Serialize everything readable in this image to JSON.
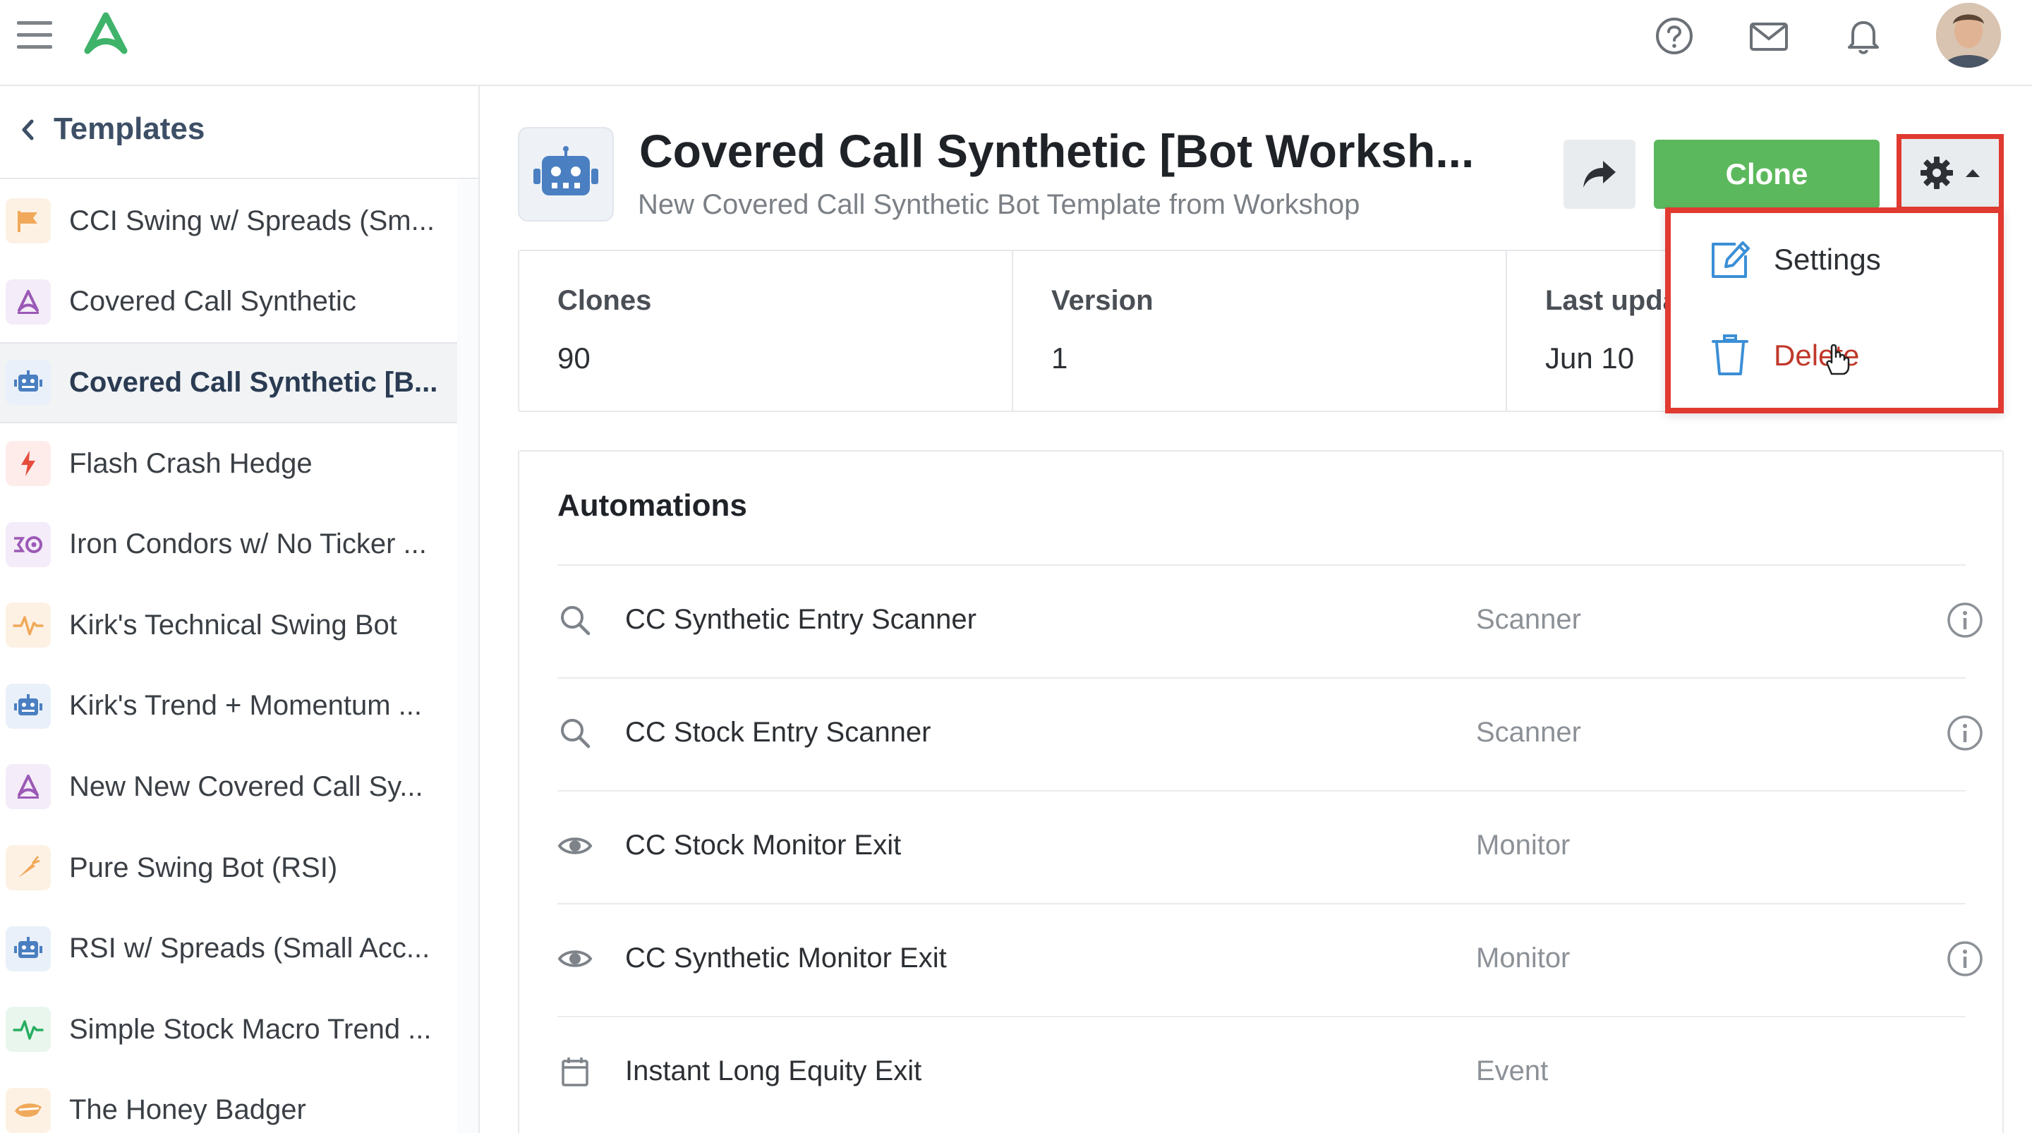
{
  "topbar": {
    "menu_icon": "hamburger-menu-icon",
    "logo_icon": "app-logo",
    "help_icon": "help-circle-icon",
    "mail_icon": "mail-icon",
    "bell_icon": "bell-icon",
    "avatar": "user-avatar"
  },
  "sidebar": {
    "title": "Templates",
    "items": [
      {
        "label": "CCI Swing w/ Spreads (Sm...",
        "icon": "flag-icon",
        "color": "#f0a95a",
        "bg": "#fdf1e4",
        "active": false
      },
      {
        "label": "Covered Call Synthetic",
        "icon": "triangle-logo-icon",
        "color": "#9b59b6",
        "bg": "#f4ecf8",
        "active": false
      },
      {
        "label": "Covered Call Synthetic [B...",
        "icon": "robot-icon",
        "color": "#4a7fc1",
        "bg": "#e9f0f9",
        "active": true
      },
      {
        "label": "Flash Crash Hedge",
        "icon": "lightning-icon",
        "color": "#e74c3c",
        "bg": "#fdecea",
        "active": false
      },
      {
        "label": "Iron Condors w/ No Ticker ...",
        "icon": "condor-icon",
        "color": "#9b59b6",
        "bg": "#f4ecf8",
        "active": false
      },
      {
        "label": "Kirk's Technical Swing Bot",
        "icon": "pulse-icon",
        "color": "#f0a95a",
        "bg": "#fdf1e4",
        "active": false
      },
      {
        "label": "Kirk's Trend + Momentum ...",
        "icon": "robot-icon",
        "color": "#4a7fc1",
        "bg": "#e9f0f9",
        "active": false
      },
      {
        "label": "New New Covered Call Sy...",
        "icon": "triangle-logo-icon",
        "color": "#9b59b6",
        "bg": "#f4ecf8",
        "active": false
      },
      {
        "label": "Pure Swing Bot (RSI)",
        "icon": "carrot-icon",
        "color": "#f0a95a",
        "bg": "#fdf1e4",
        "active": false
      },
      {
        "label": "RSI w/ Spreads (Small Acc...",
        "icon": "robot-icon",
        "color": "#4a7fc1",
        "bg": "#e9f0f9",
        "active": false
      },
      {
        "label": "Simple Stock Macro Trend ...",
        "icon": "pulse-icon",
        "color": "#27ae60",
        "bg": "#e8f6ee",
        "active": false
      },
      {
        "label": "The Honey Badger",
        "icon": "badger-icon",
        "color": "#f0a95a",
        "bg": "#fdf1e4",
        "active": false
      }
    ]
  },
  "header": {
    "title": "Covered Call Synthetic [Bot Worksh...",
    "subtitle": "New Covered Call Synthetic Bot Template from Workshop",
    "share_icon": "share-arrow-icon",
    "clone_label": "Clone",
    "gear_icon": "gear-icon",
    "caret_icon": "caret-up-icon"
  },
  "stats": [
    {
      "label": "Clones",
      "value": "90"
    },
    {
      "label": "Version",
      "value": "1"
    },
    {
      "label": "Last upda",
      "value": "Jun 10"
    }
  ],
  "dropdown": {
    "settings_label": "Settings",
    "delete_label": "Delete",
    "settings_icon": "edit-icon",
    "delete_icon": "trash-icon"
  },
  "automations": {
    "title": "Automations",
    "rows": [
      {
        "name": "CC Synthetic Entry Scanner",
        "type": "Scanner",
        "icon": "search-icon",
        "info": true
      },
      {
        "name": "CC Stock Entry Scanner",
        "type": "Scanner",
        "icon": "search-icon",
        "info": true
      },
      {
        "name": "CC Stock Monitor Exit",
        "type": "Monitor",
        "icon": "eye-icon",
        "info": false
      },
      {
        "name": "CC Synthetic Monitor Exit",
        "type": "Monitor",
        "icon": "eye-icon",
        "info": true
      },
      {
        "name": "Instant Long Equity Exit",
        "type": "Event",
        "icon": "calendar-icon",
        "info": false
      }
    ]
  },
  "colors": {
    "accent_green": "#5cb85c",
    "highlight_red": "#e03a31",
    "delete_text": "#c0392b",
    "settings_icon": "#3b8fd6"
  }
}
